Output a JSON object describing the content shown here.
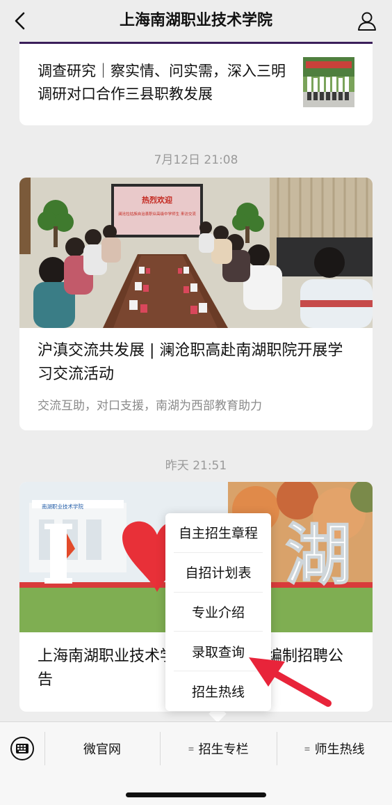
{
  "header": {
    "title": "上海南湖职业技术学院"
  },
  "articles": [
    {
      "title": "调查研究｜察实情、问实需，深入三明调研对口合作三县职教发展"
    },
    {
      "timestamp": "7月12日 21:08",
      "title": "沪滇交流共发展 | 澜沧职高赴南湖职院开展学习交流活动",
      "subtitle": "交流互助，对口支援，南湖为西部教育助力",
      "banner_text": "热烈欢迎",
      "banner_sub": "澜沧拉祜族自治县职业高级中学师生 来访交流"
    },
    {
      "timestamp": "昨天 21:51",
      "title": "上海南湖职业技术学院招聘…企业编制招聘公告",
      "sign_char": "湖",
      "building_sign": "南湖职业技术学院"
    }
  ],
  "popup_menu": {
    "items": [
      "自主招生章程",
      "自招计划表",
      "专业介绍",
      "录取查询",
      "招生热线"
    ]
  },
  "bottom_menu": {
    "tabs": [
      "微官网",
      "招生专栏",
      "师生热线"
    ]
  },
  "colors": {
    "background": "#ededed",
    "card": "#ffffff",
    "arrow": "#e8243a",
    "accent_bar": "#3b1f5a"
  },
  "icons": {
    "back": "chevron-left-icon",
    "profile": "user-icon",
    "keyboard": "keyboard-icon"
  }
}
